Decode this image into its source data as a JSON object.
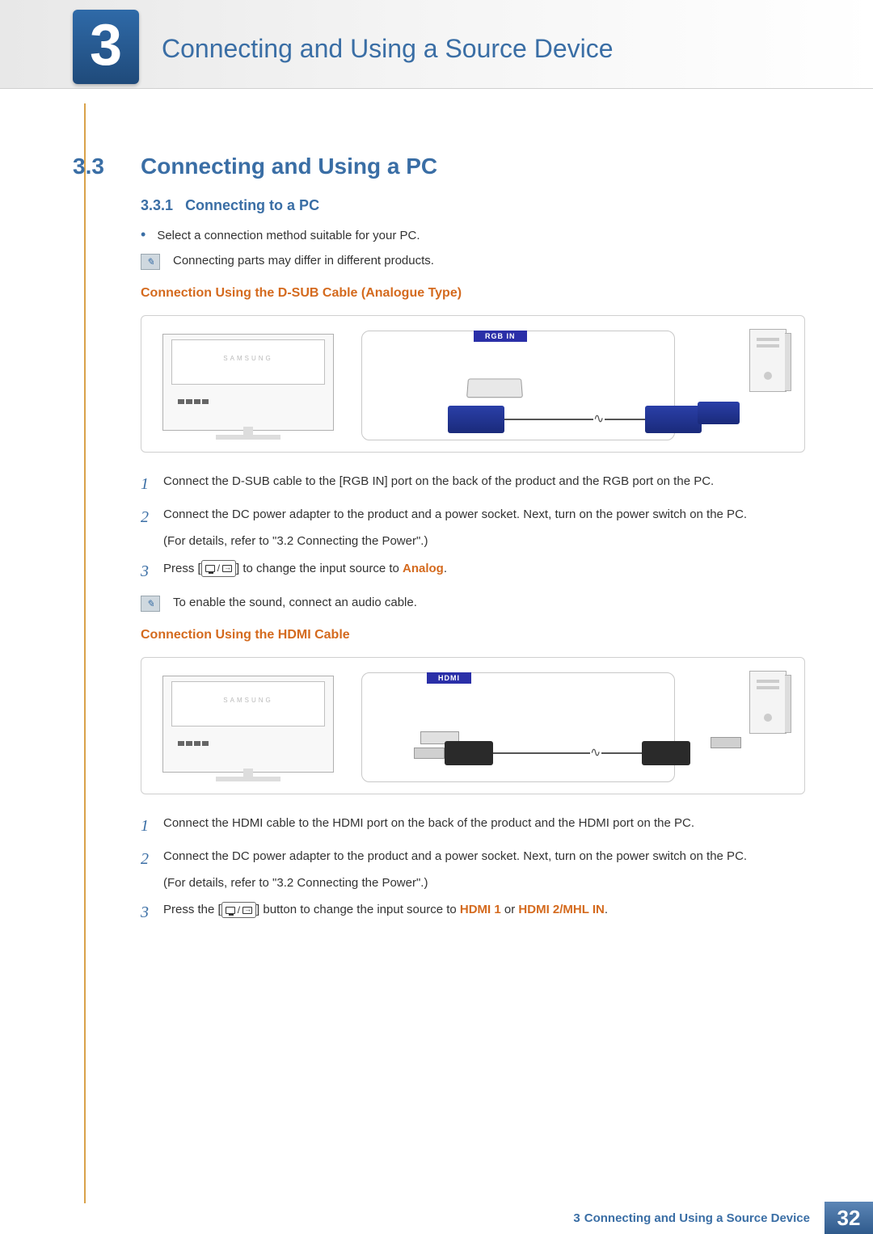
{
  "header": {
    "chapter_number": "3",
    "chapter_title": "Connecting and Using a Source Device"
  },
  "section": {
    "number": "3.3",
    "title": "Connecting and Using a PC"
  },
  "subsection": {
    "number": "3.3.1",
    "title": "Connecting to a PC"
  },
  "intro_bullet": "Select a connection method suitable for your PC.",
  "intro_note": "Connecting parts may differ in different products.",
  "dsub": {
    "heading": "Connection Using the D-SUB Cable (Analogue Type)",
    "port_label": "RGB IN",
    "brand": "SAMSUNG",
    "steps": [
      {
        "n": "1",
        "text": "Connect the D-SUB cable to the [RGB IN] port on the back of the product and the RGB port on the PC."
      },
      {
        "n": "2",
        "text": "Connect the DC power adapter to the product and a power socket. Next, turn on the power switch on the PC.",
        "detail": "(For details, refer to \"3.2 Connecting the Power\".)"
      },
      {
        "n": "3",
        "pre": "Press [",
        "post": "] to change the input source to ",
        "mode": "Analog",
        "suffix": "."
      }
    ],
    "note": "To enable the sound, connect an audio cable."
  },
  "hdmi": {
    "heading": "Connection Using the HDMI Cable",
    "port_label": "HDMI",
    "brand": "SAMSUNG",
    "steps": [
      {
        "n": "1",
        "text": "Connect the HDMI cable to the HDMI port on the back of the product and the HDMI port on the PC."
      },
      {
        "n": "2",
        "text": "Connect the DC power adapter to the product and a power socket. Next, turn on the power switch on the PC.",
        "detail": "(For details, refer to \"3.2 Connecting the Power\".)"
      },
      {
        "n": "3",
        "pre": "Press the [",
        "post": "] button to change the input source to ",
        "mode1": "HDMI 1",
        "or": " or ",
        "mode2": "HDMI 2/MHL IN",
        "suffix": "."
      }
    ]
  },
  "footer": {
    "chapter_ref": "3",
    "title": "Connecting and Using a Source Device",
    "page": "32"
  }
}
